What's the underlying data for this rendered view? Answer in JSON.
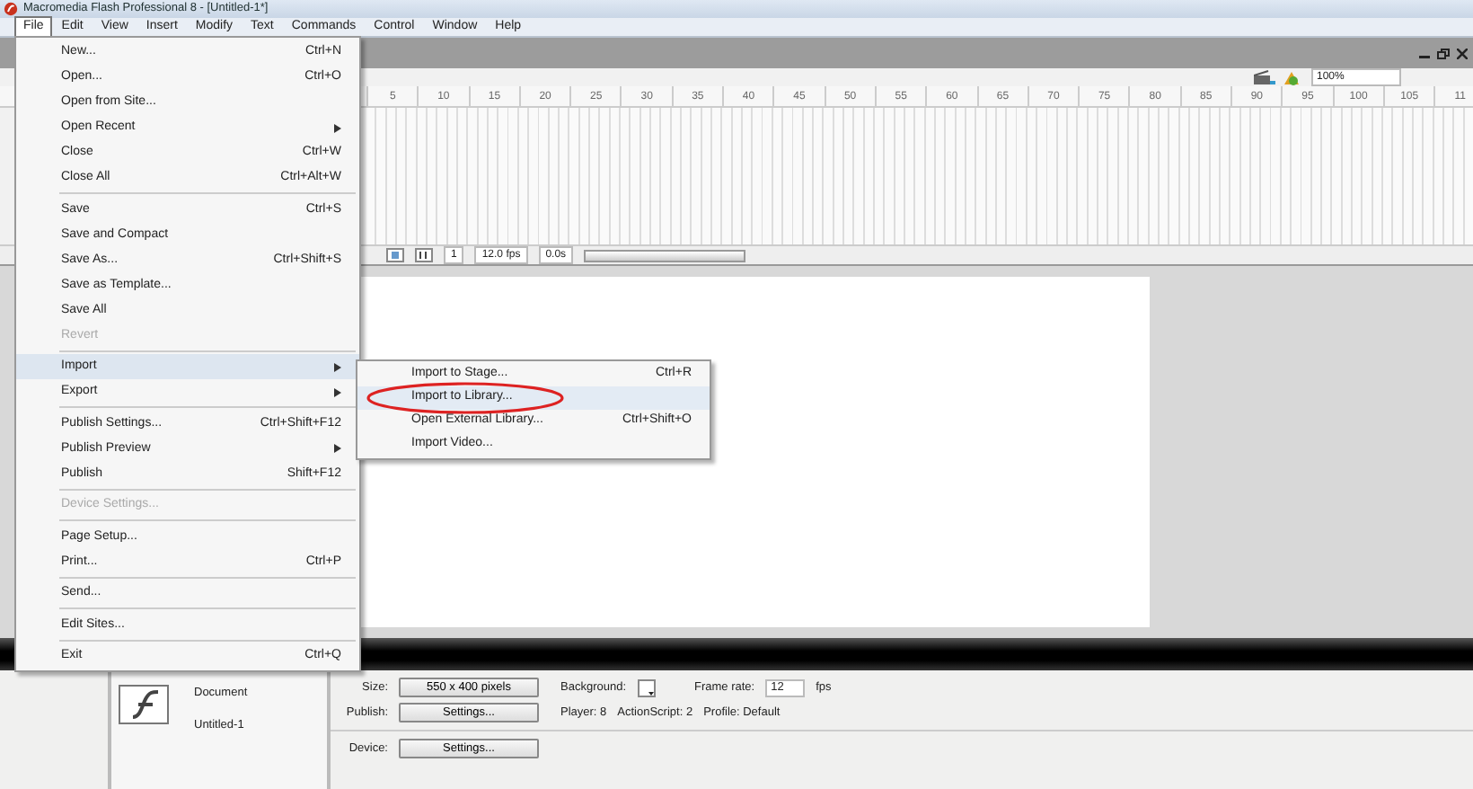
{
  "window": {
    "title": "Macromedia Flash Professional 8 - [Untitled-1*]"
  },
  "menu_bar": [
    {
      "label": "File",
      "selected": true
    },
    {
      "label": "Edit",
      "selected": false
    },
    {
      "label": "View",
      "selected": false
    },
    {
      "label": "Insert",
      "selected": false
    },
    {
      "label": "Modify",
      "selected": false
    },
    {
      "label": "Text",
      "selected": false
    },
    {
      "label": "Commands",
      "selected": false
    },
    {
      "label": "Control",
      "selected": false
    },
    {
      "label": "Window",
      "selected": false
    },
    {
      "label": "Help",
      "selected": false
    }
  ],
  "file_menu": [
    {
      "kind": "item",
      "label": "New...",
      "shortcut": "Ctrl+N",
      "disabled": false,
      "selected": false
    },
    {
      "kind": "item",
      "label": "Open...",
      "shortcut": "Ctrl+O",
      "disabled": false,
      "selected": false
    },
    {
      "kind": "item",
      "label": "Open from Site...",
      "disabled": false,
      "selected": false
    },
    {
      "kind": "submenu",
      "label": "Open Recent",
      "disabled": false,
      "selected": false
    },
    {
      "kind": "item",
      "label": "Close",
      "shortcut": "Ctrl+W",
      "disabled": false,
      "selected": false
    },
    {
      "kind": "item",
      "label": "Close All",
      "shortcut": "Ctrl+Alt+W",
      "disabled": false,
      "selected": false
    },
    {
      "kind": "separator"
    },
    {
      "kind": "item",
      "label": "Save",
      "shortcut": "Ctrl+S",
      "disabled": false,
      "selected": false
    },
    {
      "kind": "item",
      "label": "Save and Compact",
      "disabled": false,
      "selected": false
    },
    {
      "kind": "item",
      "label": "Save As...",
      "shortcut": "Ctrl+Shift+S",
      "disabled": false,
      "selected": false
    },
    {
      "kind": "item",
      "label": "Save as Template...",
      "disabled": false,
      "selected": false
    },
    {
      "kind": "item",
      "label": "Save All",
      "disabled": false,
      "selected": false
    },
    {
      "kind": "item",
      "label": "Revert",
      "disabled": true,
      "selected": false
    },
    {
      "kind": "separator"
    },
    {
      "kind": "submenu",
      "label": "Import",
      "disabled": false,
      "selected": true
    },
    {
      "kind": "submenu",
      "label": "Export",
      "disabled": false,
      "selected": false
    },
    {
      "kind": "separator"
    },
    {
      "kind": "item",
      "label": "Publish Settings...",
      "shortcut": "Ctrl+Shift+F12",
      "disabled": false,
      "selected": false
    },
    {
      "kind": "submenu",
      "label": "Publish Preview",
      "disabled": false,
      "selected": false
    },
    {
      "kind": "item",
      "label": "Publish",
      "shortcut": "Shift+F12",
      "disabled": false,
      "selected": false
    },
    {
      "kind": "separator"
    },
    {
      "kind": "item",
      "label": "Device Settings...",
      "disabled": true,
      "selected": false
    },
    {
      "kind": "separator"
    },
    {
      "kind": "item",
      "label": "Page Setup...",
      "disabled": false,
      "selected": false
    },
    {
      "kind": "item",
      "label": "Print...",
      "shortcut": "Ctrl+P",
      "disabled": false,
      "selected": false
    },
    {
      "kind": "separator"
    },
    {
      "kind": "item",
      "label": "Send...",
      "disabled": false,
      "selected": false
    },
    {
      "kind": "separator"
    },
    {
      "kind": "item",
      "label": "Edit Sites...",
      "disabled": false,
      "selected": false
    },
    {
      "kind": "separator"
    },
    {
      "kind": "item",
      "label": "Exit",
      "shortcut": "Ctrl+Q",
      "disabled": false,
      "selected": false
    }
  ],
  "import_submenu": [
    {
      "label": "Import to Stage...",
      "shortcut": "Ctrl+R",
      "selected": false,
      "circled": false
    },
    {
      "label": "Import to Library...",
      "selected": true,
      "circled": true
    },
    {
      "label": "Open External Library...",
      "shortcut": "Ctrl+Shift+O",
      "selected": false,
      "circled": false
    },
    {
      "label": "Import Video...",
      "selected": false,
      "circled": false
    }
  ],
  "zoom": "100%",
  "frame_numbers": [
    "5",
    "10",
    "15",
    "20",
    "25",
    "30",
    "35",
    "40",
    "45",
    "50",
    "55",
    "60",
    "65",
    "70",
    "75",
    "80",
    "85",
    "90",
    "95",
    "100",
    "105",
    "11"
  ],
  "timeline_status": {
    "frame": "1",
    "frame_rate": "12.0 fps",
    "time": "0.0s"
  },
  "properties": {
    "doc_type": "Document",
    "doc_name": "Untitled-1",
    "size_label": "Size:",
    "size": "550 x 400 pixels",
    "background_label": "Background:",
    "frame_rate_label": "Frame rate:",
    "frame_rate": "12",
    "fps": "fps",
    "publish_label": "Publish:",
    "publish_button": "Settings...",
    "player": "Player: 8",
    "actionscript": "ActionScript: 2",
    "profile": "Profile: Default",
    "device_label": "Device:",
    "device_button": "Settings..."
  }
}
